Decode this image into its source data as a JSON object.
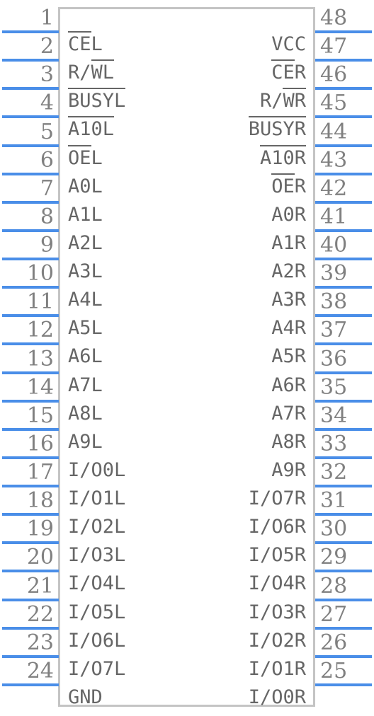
{
  "symbol": {
    "package": "SOIC-48",
    "accent_color": "#4a8ee8",
    "body_border_color": "#c4c4c4",
    "label_color": "#666666",
    "number_color": "#808080",
    "pin_count": 48,
    "pins_per_side": 24
  },
  "left_pins": [
    {
      "number": "1",
      "label": "CEL",
      "overbar": "CE"
    },
    {
      "number": "2",
      "label": "R/WL",
      "overbar": "WL"
    },
    {
      "number": "3",
      "label": "BUSYL",
      "overbar": "BUSYL"
    },
    {
      "number": "4",
      "label": "A10L",
      "overbar": "A10L"
    },
    {
      "number": "5",
      "label": "OEL",
      "overbar": "OE"
    },
    {
      "number": "6",
      "label": "A0L",
      "overbar": ""
    },
    {
      "number": "7",
      "label": "A1L",
      "overbar": ""
    },
    {
      "number": "8",
      "label": "A2L",
      "overbar": ""
    },
    {
      "number": "9",
      "label": "A3L",
      "overbar": ""
    },
    {
      "number": "10",
      "label": "A4L",
      "overbar": ""
    },
    {
      "number": "11",
      "label": "A5L",
      "overbar": ""
    },
    {
      "number": "12",
      "label": "A6L",
      "overbar": ""
    },
    {
      "number": "13",
      "label": "A7L",
      "overbar": ""
    },
    {
      "number": "14",
      "label": "A8L",
      "overbar": ""
    },
    {
      "number": "15",
      "label": "A9L",
      "overbar": ""
    },
    {
      "number": "16",
      "label": "I/O0L",
      "overbar": ""
    },
    {
      "number": "17",
      "label": "I/O1L",
      "overbar": ""
    },
    {
      "number": "18",
      "label": "I/O2L",
      "overbar": ""
    },
    {
      "number": "19",
      "label": "I/O3L",
      "overbar": ""
    },
    {
      "number": "20",
      "label": "I/O4L",
      "overbar": ""
    },
    {
      "number": "21",
      "label": "I/O5L",
      "overbar": ""
    },
    {
      "number": "22",
      "label": "I/O6L",
      "overbar": ""
    },
    {
      "number": "23",
      "label": "I/O7L",
      "overbar": ""
    },
    {
      "number": "24",
      "label": "GND",
      "overbar": ""
    }
  ],
  "right_pins": [
    {
      "number": "48",
      "label": "VCC",
      "overbar": ""
    },
    {
      "number": "47",
      "label": "CER",
      "overbar": "CE"
    },
    {
      "number": "46",
      "label": "R/WR",
      "overbar": "WR"
    },
    {
      "number": "45",
      "label": "BUSYR",
      "overbar": "BUSYR"
    },
    {
      "number": "44",
      "label": "A10R",
      "overbar": "A10R"
    },
    {
      "number": "43",
      "label": "OER",
      "overbar": "OE"
    },
    {
      "number": "42",
      "label": "A0R",
      "overbar": ""
    },
    {
      "number": "41",
      "label": "A1R",
      "overbar": ""
    },
    {
      "number": "40",
      "label": "A2R",
      "overbar": ""
    },
    {
      "number": "39",
      "label": "A3R",
      "overbar": ""
    },
    {
      "number": "38",
      "label": "A4R",
      "overbar": ""
    },
    {
      "number": "37",
      "label": "A5R",
      "overbar": ""
    },
    {
      "number": "36",
      "label": "A6R",
      "overbar": ""
    },
    {
      "number": "35",
      "label": "A7R",
      "overbar": ""
    },
    {
      "number": "34",
      "label": "A8R",
      "overbar": ""
    },
    {
      "number": "33",
      "label": "A9R",
      "overbar": ""
    },
    {
      "number": "32",
      "label": "I/O7R",
      "overbar": ""
    },
    {
      "number": "31",
      "label": "I/O6R",
      "overbar": ""
    },
    {
      "number": "30",
      "label": "I/O5R",
      "overbar": ""
    },
    {
      "number": "29",
      "label": "I/O4R",
      "overbar": ""
    },
    {
      "number": "28",
      "label": "I/O3R",
      "overbar": ""
    },
    {
      "number": "27",
      "label": "I/O2R",
      "overbar": ""
    },
    {
      "number": "26",
      "label": "I/O1R",
      "overbar": ""
    },
    {
      "number": "25",
      "label": "I/O0R",
      "overbar": ""
    }
  ]
}
